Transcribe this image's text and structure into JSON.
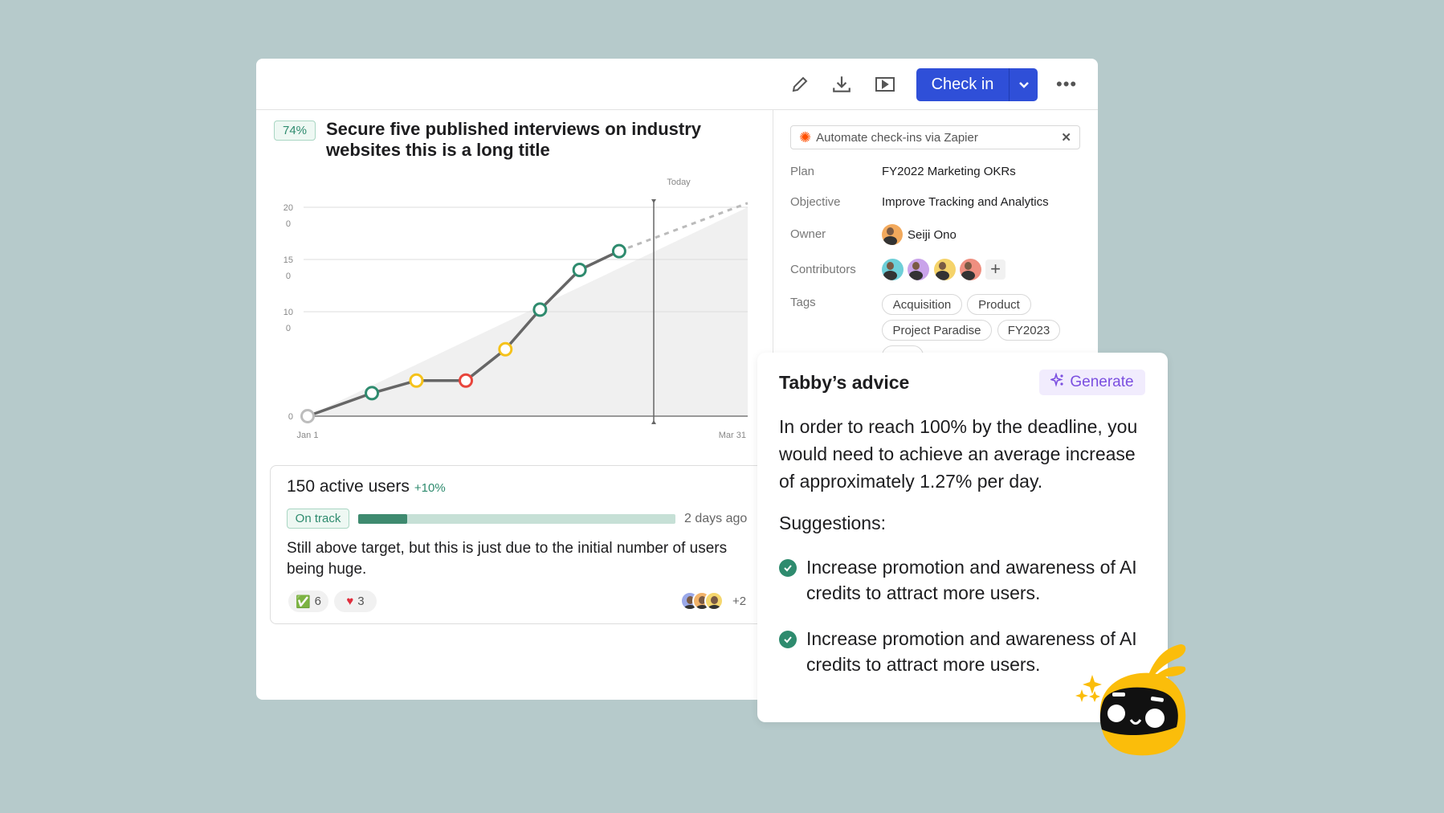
{
  "toolbar": {
    "icons": [
      "pencil-icon",
      "download-icon",
      "present-icon"
    ],
    "checkin_label": "Check in",
    "primary_color": "#2f4fd8"
  },
  "key_result": {
    "progress_badge": "74%",
    "title": "Secure five published interviews on industry websites this is a long title"
  },
  "chart_data": {
    "type": "line",
    "x_start_label": "Jan 1",
    "x_end_label": "Mar 31",
    "today_label": "Today",
    "ylim": [
      0,
      200
    ],
    "y_ticks": [
      "200",
      "150",
      "100",
      "0"
    ],
    "y_tick_values": [
      200,
      150,
      100,
      0
    ],
    "xlim": [
      "Jan 1",
      "Mar 31"
    ],
    "grid": true,
    "points": [
      {
        "x": "Jan 1",
        "y": 0,
        "status": "none"
      },
      {
        "x": "Jan 14",
        "y": 22,
        "status": "on-track"
      },
      {
        "x": "Jan 23",
        "y": 34,
        "status": "at-risk"
      },
      {
        "x": "Feb 2",
        "y": 34,
        "status": "off-track"
      },
      {
        "x": "Feb 10",
        "y": 64,
        "status": "at-risk"
      },
      {
        "x": "Feb 17",
        "y": 102,
        "status": "on-track"
      },
      {
        "x": "Feb 25",
        "y": 140,
        "status": "on-track"
      },
      {
        "x": "Mar 5",
        "y": 158,
        "status": "on-track"
      }
    ],
    "projection": {
      "x": "Mar 31",
      "y": 204
    },
    "target_line": [
      {
        "x": "Jan 1",
        "y": 0
      },
      {
        "x": "Mar 31",
        "y": 200
      }
    ],
    "today": "Mar 12",
    "status_colors": {
      "none": "#bdbdbd",
      "on-track": "#2e8b6e",
      "at-risk": "#f5c21b",
      "off-track": "#e8453c"
    }
  },
  "checkin": {
    "title": "150 active users",
    "delta": "+10%",
    "status": "On track",
    "progress": 0.155,
    "time": "2 days ago",
    "comment": "Still above target, but this is just due to the initial number of users being huge.",
    "reactions": [
      {
        "emoji": "✅",
        "count": "6"
      },
      {
        "emoji": "❤️",
        "count": "3"
      }
    ],
    "more_viewers": "+2"
  },
  "details": {
    "zapier_banner": "Automate check-ins via Zapier",
    "plan_label": "Plan",
    "plan": "FY2022 Marketing OKRs",
    "objective_label": "Objective",
    "objective": "Improve Tracking and Analytics",
    "owner_label": "Owner",
    "owner": "Seiji Ono",
    "contributors_label": "Contributors",
    "tags_label": "Tags",
    "tags": [
      "Acquisition",
      "Product",
      "Project Paradise",
      "FY2023"
    ]
  },
  "advice": {
    "title": "Tabby’s advice",
    "generate_label": "Generate",
    "paragraph": "In order to reach 100% by the deadline, you would need to achieve an average increase of approximately 1.27% per day.",
    "suggestions_label": "Suggestions:",
    "suggestions": [
      "Increase promotion and awareness of AI credits to attract more users.",
      "Increase promotion and awareness of AI credits to attract more users."
    ],
    "accent_color": "#7b4fe0"
  }
}
